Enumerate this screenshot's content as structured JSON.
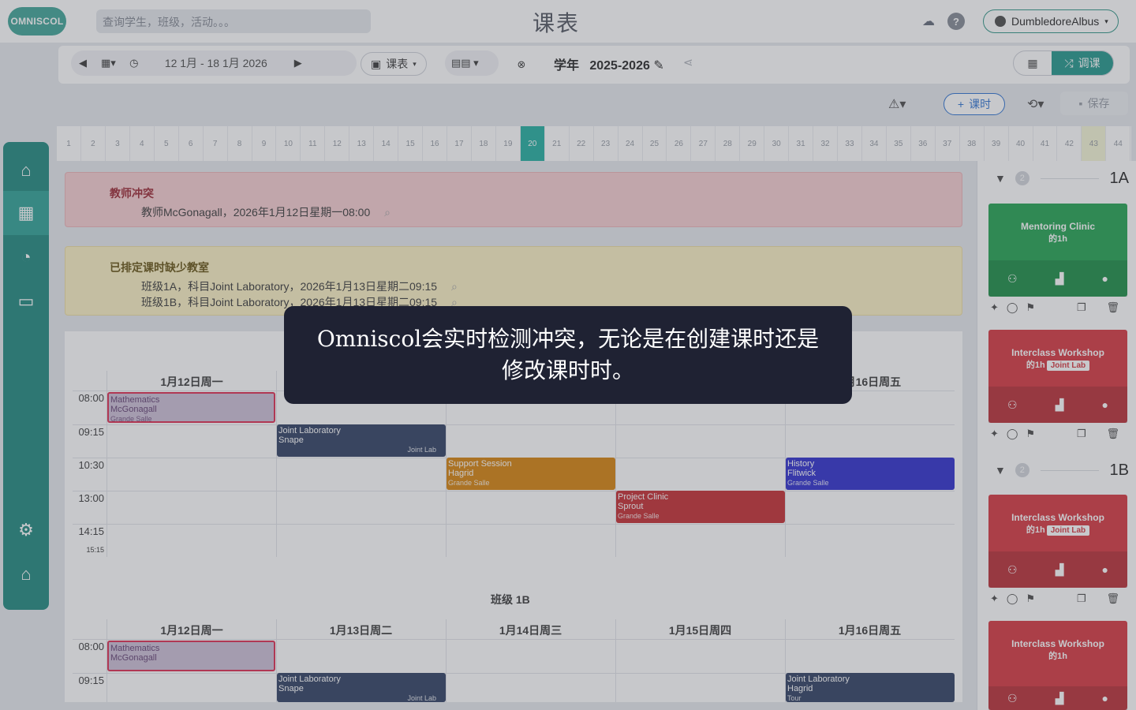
{
  "header": {
    "logo": "OMNISCOL",
    "search_placeholder": "查询学生，班级，活动。。。",
    "title": "课表",
    "user": "DumbledoreAlbus"
  },
  "toolbar": {
    "date_range": "12 1月 - 18 1月 2026",
    "timetable_label": "课表",
    "year_label": "学年",
    "year_value": "2025-2026",
    "adjust_label": "调课"
  },
  "actions": {
    "add_lesson": "课时",
    "save": "保存"
  },
  "weeks": [
    "1",
    "2",
    "3",
    "4",
    "5",
    "6",
    "7",
    "8",
    "9",
    "10",
    "11",
    "12",
    "13",
    "14",
    "15",
    "16",
    "17",
    "18",
    "19",
    "20",
    "21",
    "22",
    "23",
    "24",
    "25",
    "26",
    "27",
    "28",
    "29",
    "30",
    "31",
    "32",
    "33",
    "34",
    "35",
    "36",
    "37",
    "38",
    "39",
    "40",
    "41",
    "42",
    "43",
    "44"
  ],
  "active_week": "20",
  "alerts": {
    "teacher_conflict": {
      "title": "教师冲突",
      "line": "教师McGonagall，2026年1月12日星期一08:00"
    },
    "missing_room": {
      "title": "已排定课时缺少教室",
      "lines": [
        "班级1A，科目Joint Laboratory，2026年1月13日星期二09:15",
        "班级1B，科目Joint Laboratory，2026年1月13日星期二09:15"
      ]
    }
  },
  "schedule": {
    "days": [
      "1月12日周一",
      "1月13日周二",
      "1月14日周三",
      "1月15日周四",
      "1月16日周五"
    ],
    "times": [
      "08:00",
      "09:15",
      "10:30",
      "13:00",
      "14:15"
    ],
    "end_time": "15:15",
    "class_1b_title": "班级 1B",
    "lessons_1a": {
      "math": {
        "subject": "Mathematics",
        "teacher": "McGonagall",
        "room": "Grande Salle"
      },
      "joint": {
        "subject": "Joint Laboratory",
        "teacher": "Snape",
        "room": "Joint Lab"
      },
      "support": {
        "subject": "Support Session",
        "teacher": "Hagrid",
        "room": "Grande Salle"
      },
      "history": {
        "subject": "History",
        "teacher": "Flitwick",
        "room": "Grande Salle"
      },
      "project": {
        "subject": "Project Clinic",
        "teacher": "Sprout",
        "room": "Grande Salle"
      }
    },
    "lessons_1b": {
      "math": {
        "subject": "Mathematics",
        "teacher": "McGonagall"
      },
      "joint": {
        "subject": "Joint Laboratory",
        "teacher": "Snape",
        "room": "Joint Lab"
      },
      "joint2": {
        "subject": "Joint Laboratory",
        "teacher": "Hagrid",
        "room": "Tour"
      }
    }
  },
  "right_panel": {
    "group_1a": {
      "count": "2",
      "name": "1A"
    },
    "group_1b": {
      "count": "2",
      "name": "1B"
    },
    "cards": {
      "c1": {
        "title": "Mentoring Clinic",
        "sub": "的1h"
      },
      "c2": {
        "title": "Interclass Workshop",
        "sub": "的1h",
        "badge": "Joint Lab"
      },
      "c3": {
        "title": "Interclass Workshop",
        "sub": "的1h",
        "badge": "Joint Lab"
      },
      "c4": {
        "title": "Interclass Workshop",
        "sub": "的1h"
      }
    },
    "more": "..."
  },
  "tooltip": {
    "text": "Omniscol会实时检测冲突，无论是在创建课时还是修改课时时。"
  },
  "colors": {
    "brand": "#2c8f86",
    "conflict": "#e0385a",
    "joint_lab": "#3b4a6b",
    "support": "#d98a1a",
    "history": "#3a3ad0",
    "project": "#c8383c",
    "card_green": "#2ea85a",
    "card_red": "#d8424a"
  }
}
